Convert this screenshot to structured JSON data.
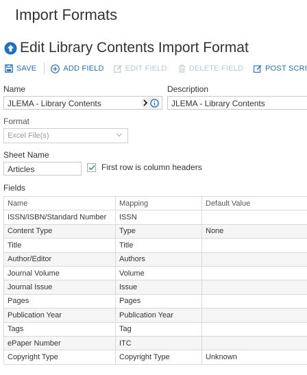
{
  "page_title": "Import Formats",
  "edit_title": "Edit Library Contents Import Format",
  "toolbar": {
    "save": "SAVE",
    "add_field": "ADD FIELD",
    "edit_field": "EDIT FIELD",
    "delete_field": "DELETE FIELD",
    "post_script": "POST SCRIPT"
  },
  "form": {
    "name_label": "Name",
    "name_value": "JLEMA - Library Contents",
    "description_label": "Description",
    "description_value": "JLEMA - Library Contents",
    "format_label": "Format",
    "format_value": "Excel File(s)",
    "sheet_label": "Sheet Name",
    "sheet_value": "Articles",
    "first_row_label": "First row is column headers",
    "first_row_checked": true,
    "fields_label": "Fields"
  },
  "table": {
    "columns": [
      "Name",
      "Mapping",
      "Default Value"
    ],
    "rows": [
      [
        "ISSN/ISBN/Standard Number",
        "ISSN",
        ""
      ],
      [
        "Content Type",
        "Type",
        "None"
      ],
      [
        "Title",
        "Title",
        ""
      ],
      [
        "Author/Editor",
        "Authors",
        ""
      ],
      [
        "Journal Volume",
        "Volume",
        ""
      ],
      [
        "Journal Issue",
        "Issue",
        ""
      ],
      [
        "Pages",
        "Pages",
        ""
      ],
      [
        "Publication Year",
        "Publication Year",
        ""
      ],
      [
        "Tags",
        "Tag",
        ""
      ],
      [
        "ePaper Number",
        "ITC",
        ""
      ],
      [
        "Copyright Type",
        "Copyright Type",
        "Unknown"
      ]
    ]
  },
  "colors": {
    "accent": "#1f6fbf",
    "disabled": "#b6c8db",
    "check": "#3a9b3a"
  },
  "icons": [
    "edit-circle-icon",
    "save-icon",
    "add-circle-icon",
    "edit-icon",
    "trash-icon",
    "script-icon",
    "chevron-right-icon",
    "info-icon",
    "chevron-down-icon",
    "check-icon"
  ]
}
